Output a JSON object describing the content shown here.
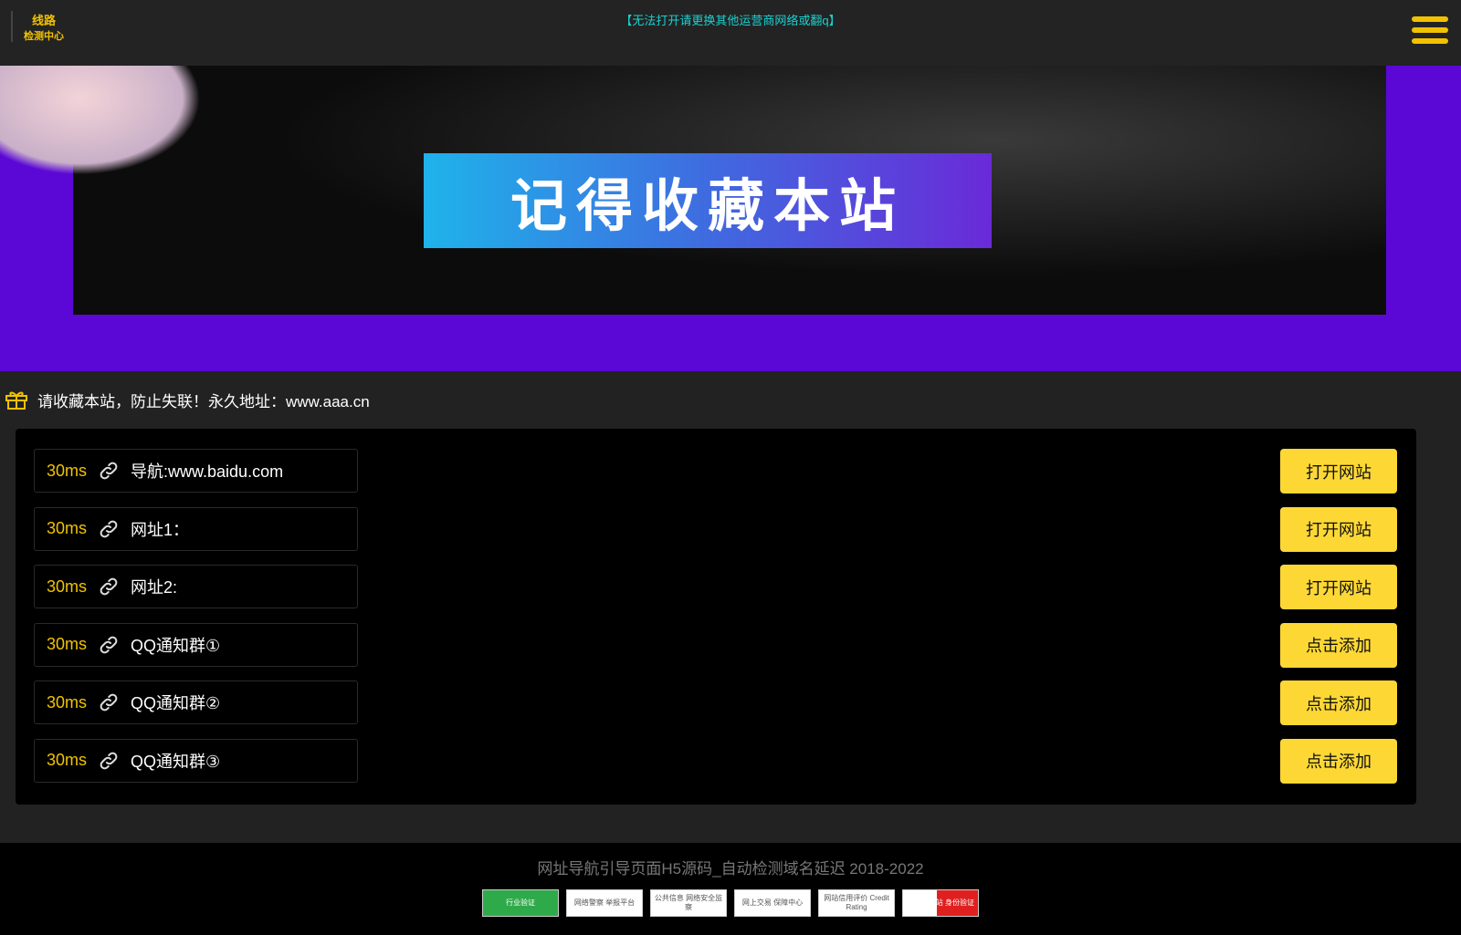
{
  "header": {
    "logo_line1": "线路",
    "logo_line2": "检测中心",
    "notice": "【无法打开请更换其他运营商网络或翻q】"
  },
  "banner": {
    "text": "记得收藏本站"
  },
  "tip": {
    "text": "请收藏本站，防止失联！永久地址：www.aaa.cn"
  },
  "rows": [
    {
      "latency": "30ms",
      "label": "导航:www.baidu.com",
      "button": "打开网站"
    },
    {
      "latency": "30ms",
      "label": "网址1：",
      "button": "打开网站"
    },
    {
      "latency": "30ms",
      "label": "网址2:",
      "button": "打开网站"
    },
    {
      "latency": "30ms",
      "label": "QQ通知群①",
      "button": "点击添加"
    },
    {
      "latency": "30ms",
      "label": "QQ通知群②",
      "button": "点击添加"
    },
    {
      "latency": "30ms",
      "label": "QQ通知群③",
      "button": "点击添加"
    }
  ],
  "footer": {
    "copyright": "网址导航引导页面H5源码_自动检测域名延迟 2018-2022",
    "badges": [
      "行业验证",
      "网络警察 举报平台",
      "公共信息 网络安全监察",
      "网上交易 保障中心",
      "网站信用评价 Credit Rating",
      "可信网站 身份验证"
    ]
  },
  "colors": {
    "accent": "#f2c200",
    "button": "#fdd835",
    "banner_bg": "#5b08d6",
    "notice": "#1bd1d1"
  }
}
